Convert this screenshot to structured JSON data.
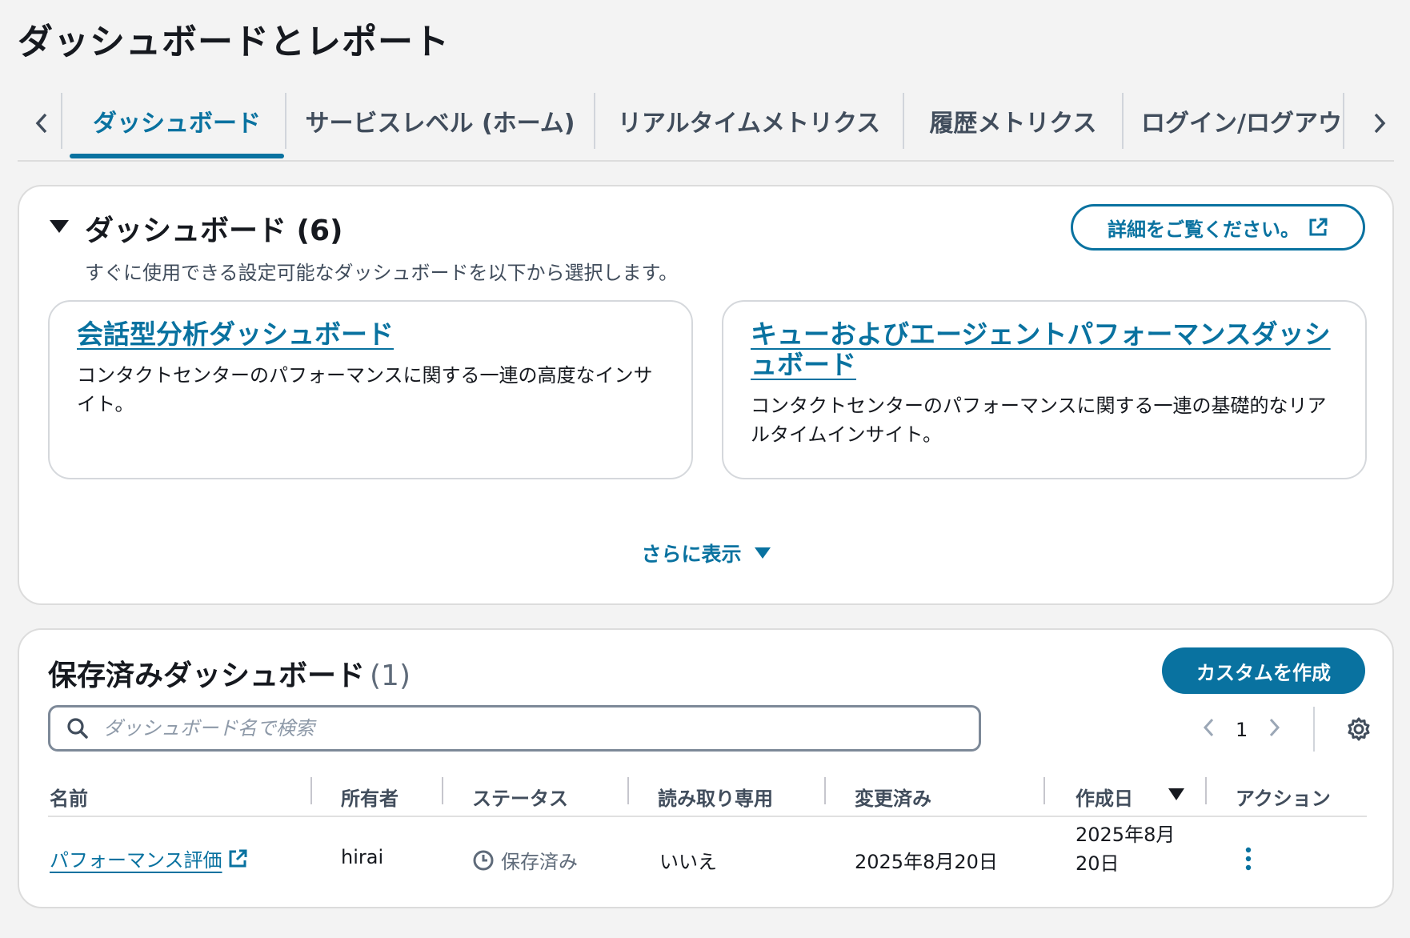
{
  "page": {
    "title": "ダッシュボードとレポート"
  },
  "tabs": [
    {
      "label": "ダッシュボード",
      "active": true
    },
    {
      "label": "サービスレベル (ホーム)"
    },
    {
      "label": "リアルタイムメトリクス"
    },
    {
      "label": "履歴メトリクス"
    },
    {
      "label": "ログイン/ログアウ"
    }
  ],
  "dashboards": {
    "title": "ダッシュボード (6)",
    "description": "すぐに使用できる設定可能なダッシュボードを以下から選択します。",
    "learn_more_label": "詳細をご覧ください。",
    "cards": [
      {
        "title": "会話型分析ダッシュボード",
        "description": "コンタクトセンターのパフォーマンスに関する一連の高度なインサイト。"
      },
      {
        "title": "キューおよびエージェントパフォーマンスダッシュボード",
        "description": "コンタクトセンターのパフォーマンスに関する一連の基礎的なリアルタイムインサイト。"
      }
    ],
    "show_more_label": "さらに表示"
  },
  "saved": {
    "title": "保存済みダッシュボード",
    "count": "(1)",
    "create_label": "カスタムを作成",
    "search_placeholder": "ダッシュボード名で検索",
    "page": "1",
    "columns": [
      "名前",
      "所有者",
      "ステータス",
      "読み取り専用",
      "変更済み",
      "作成日",
      "アクション"
    ],
    "rows": [
      {
        "name": "パフォーマンス評価",
        "owner": "hirai",
        "status": "保存済み",
        "read_only": "いいえ",
        "modified": "2025年8月20日",
        "created_line1": "2025年8月",
        "created_line2": "20日"
      }
    ]
  },
  "colors": {
    "accent": "#0972a0",
    "text": "#16191f",
    "muted": "#5f6b7a",
    "background": "#f3f3f3"
  }
}
